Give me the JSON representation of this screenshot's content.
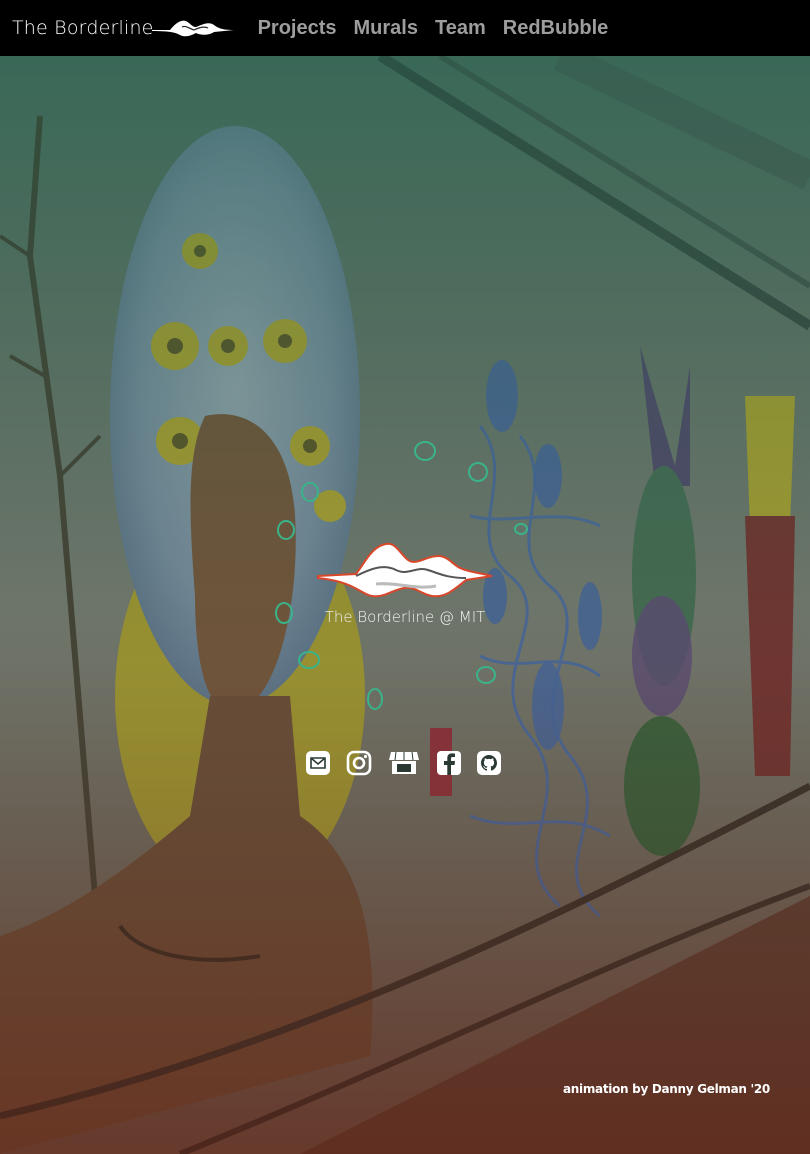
{
  "nav": {
    "brand": "The Borderline",
    "links": [
      "Projects",
      "Murals",
      "Team",
      "RedBubble"
    ]
  },
  "hero": {
    "title": "The Borderline @ MIT",
    "credit": "animation by Danny Gelman '20",
    "social_icons": [
      "email-icon",
      "instagram-icon",
      "store-icon",
      "facebook-icon",
      "github-icon"
    ]
  },
  "colors": {
    "nav_bg": "#000000",
    "nav_link": "#9d9d9d",
    "overlay_top": "#2f5a4a",
    "overlay_bottom": "#5a2f26",
    "logo_outline": "#d9472b"
  }
}
